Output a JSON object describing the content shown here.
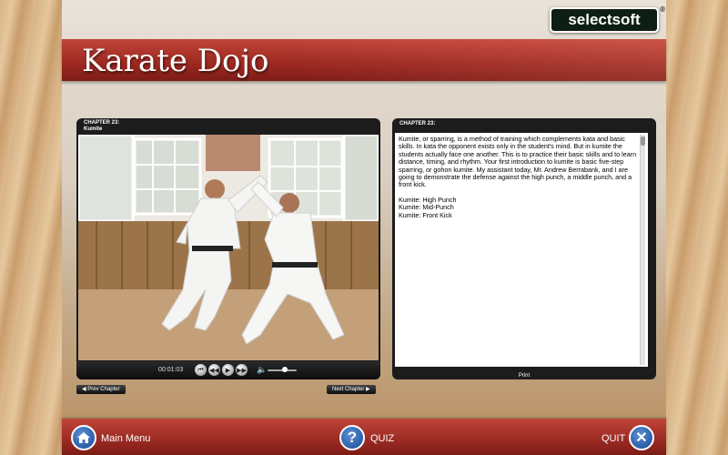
{
  "brand": {
    "logo_text": "selectsoft",
    "reg_mark": "®"
  },
  "header": {
    "title": "Karate Dojo"
  },
  "video_panel": {
    "chapter_label": "CHAPTER 23:",
    "chapter_name": "Kumite",
    "time": "00:01:03",
    "volume_level": 0.6
  },
  "chapter_nav": {
    "prev_label": "◀ Prev Chapter",
    "next_label": "Next Chapter ▶"
  },
  "text_panel": {
    "chapter_label": "CHAPTER 23:",
    "body": "Kumite, or sparring, is a method of training which complements kata and basic skills. In kata the opponent exists only in the student's mind. But in kumite the students actually face one another. This is to practice their basic skills and to learn distance, timing, and rhythm. Your first introduction to kumite is basic five-step sparring, or gohon kumite. My assistant today, Mr. Andrew Berrabank, and I are going to demonstrate the defense against the high punch, a middle punch, and a front kick.",
    "items": [
      "Kumite: High Punch",
      "Kumite: Mid-Punch",
      "Kumite: Front Kick"
    ],
    "print_label": "Print"
  },
  "bottom_nav": {
    "main_menu_label": "Main Menu",
    "quiz_label": "QUIZ",
    "quit_label": "QUIT"
  },
  "icons": {
    "home": "home-icon",
    "help": "question-icon",
    "quit": "close-icon"
  }
}
